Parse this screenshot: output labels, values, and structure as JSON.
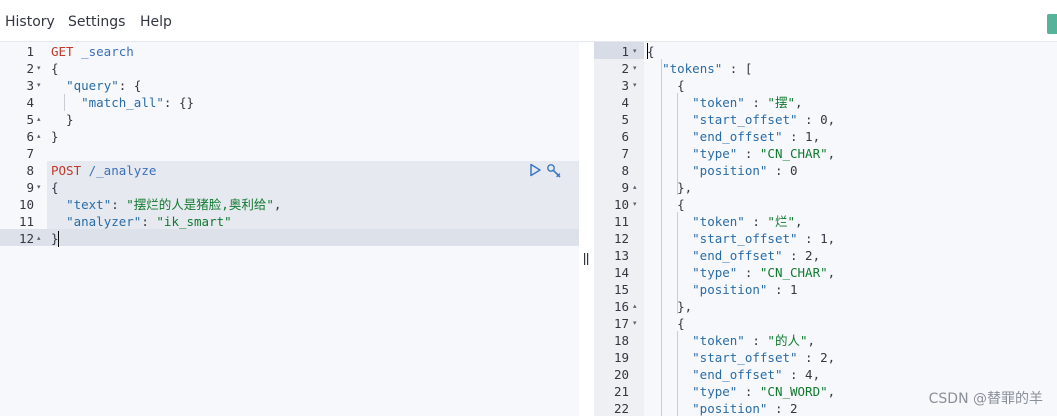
{
  "menu": {
    "history": "History",
    "settings": "Settings",
    "help": "Help"
  },
  "colors": {
    "accent": "#54b399",
    "method": "#c0392b",
    "key": "#2a6ca4",
    "string": "#117a2f"
  },
  "request_editor": {
    "line_numbers": [
      "1",
      "2",
      "3",
      "4",
      "5",
      "6",
      "7",
      "8",
      "9",
      "10",
      "11",
      "12"
    ],
    "request1": {
      "method": "GET",
      "path": " _search",
      "query_key": "\"query\"",
      "match_all_key": "\"match_all\"",
      "match_all_value": "{}"
    },
    "request2": {
      "method": "POST",
      "path": " /_analyze",
      "text_key": "\"text\"",
      "text_value": "\"摆烂的人是猪脸,奥利给\"",
      "analyzer_key": "\"analyzer\"",
      "analyzer_value": "\"ik_smart\""
    },
    "actions": {
      "send_icon": "play-icon",
      "settings_icon": "wrench-icon"
    }
  },
  "response_editor": {
    "line_numbers": [
      "1",
      "2",
      "3",
      "4",
      "5",
      "6",
      "7",
      "8",
      "9",
      "10",
      "11",
      "12",
      "13",
      "14",
      "15",
      "16",
      "17",
      "18",
      "19",
      "20",
      "21",
      "22"
    ],
    "tokens_key": "\"tokens\"",
    "tokens": [
      {
        "token": "\"摆\"",
        "start_offset": "0",
        "end_offset": "1",
        "type": "\"CN_CHAR\"",
        "position": "0"
      },
      {
        "token": "\"烂\"",
        "start_offset": "1",
        "end_offset": "2",
        "type": "\"CN_CHAR\"",
        "position": "1"
      },
      {
        "token": "\"的人\"",
        "start_offset": "2",
        "end_offset": "4",
        "type": "\"CN_WORD\"",
        "position": "2"
      }
    ],
    "labels": {
      "token": "\"token\"",
      "start_offset": "\"start_offset\"",
      "end_offset": "\"end_offset\"",
      "type": "\"type\"",
      "position": "\"position\""
    }
  },
  "watermark": "CSDN @替罪的羊"
}
